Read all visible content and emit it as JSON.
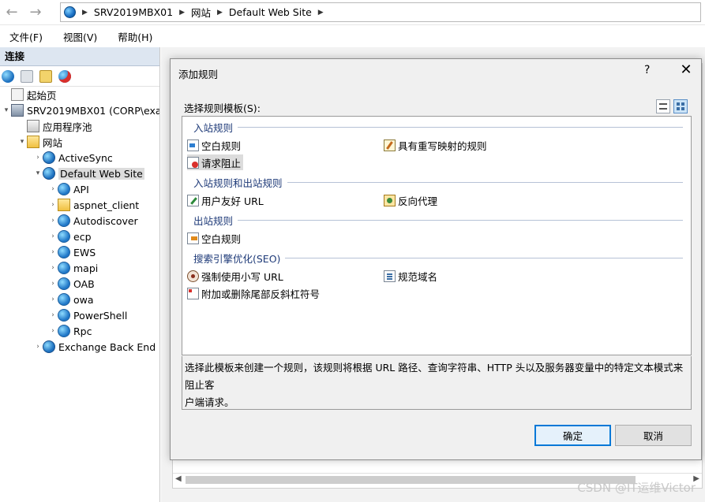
{
  "address_bar": {
    "back_icon": "back-arrow-icon",
    "forward_icon": "forward-arrow-icon",
    "crumbs": [
      "SRV2019MBX01",
      "网站",
      "Default Web Site"
    ]
  },
  "menu": [
    "文件(F)",
    "视图(V)",
    "帮助(H)"
  ],
  "connections": {
    "header": "连接",
    "tree": [
      {
        "label": "起始页",
        "level": 0,
        "icon": "start-page-icon",
        "twisty": ""
      },
      {
        "label": "SRV2019MBX01 (CORP\\exa",
        "level": 0,
        "icon": "server-icon",
        "twisty": "▾"
      },
      {
        "label": "应用程序池",
        "level": 1,
        "icon": "app-pool-icon",
        "twisty": ""
      },
      {
        "label": "网站",
        "level": 1,
        "icon": "sites-folder-icon",
        "twisty": "▾"
      },
      {
        "label": "ActiveSync",
        "level": 2,
        "icon": "site-icon",
        "twisty": "›"
      },
      {
        "label": "Default Web Site",
        "level": 2,
        "icon": "site-icon",
        "twisty": "▾",
        "selected": true
      },
      {
        "label": "API",
        "level": 3,
        "icon": "app-icon",
        "twisty": "›"
      },
      {
        "label": "aspnet_client",
        "level": 3,
        "icon": "folder-icon",
        "twisty": "›"
      },
      {
        "label": "Autodiscover",
        "level": 3,
        "icon": "app-icon",
        "twisty": "›"
      },
      {
        "label": "ecp",
        "level": 3,
        "icon": "app-icon",
        "twisty": "›"
      },
      {
        "label": "EWS",
        "level": 3,
        "icon": "app-icon",
        "twisty": "›"
      },
      {
        "label": "mapi",
        "level": 3,
        "icon": "app-icon",
        "twisty": "›"
      },
      {
        "label": "OAB",
        "level": 3,
        "icon": "app-icon",
        "twisty": "›"
      },
      {
        "label": "owa",
        "level": 3,
        "icon": "app-icon",
        "twisty": "›"
      },
      {
        "label": "PowerShell",
        "level": 3,
        "icon": "app-icon",
        "twisty": "›"
      },
      {
        "label": "Rpc",
        "level": 3,
        "icon": "app-icon",
        "twisty": "›"
      },
      {
        "label": "Exchange Back End",
        "level": 2,
        "icon": "site-icon",
        "twisty": "›"
      }
    ]
  },
  "dialog": {
    "title": "添加规则",
    "help": "?",
    "close": "✕",
    "prompt": "选择规则模板(S):",
    "groups": [
      {
        "title": "入站规则"
      },
      {
        "title": "入站规则和出站规则"
      },
      {
        "title": "出站规则"
      },
      {
        "title": "搜索引擎优化(SEO)"
      }
    ],
    "templates": {
      "blank_inbound": "空白规则",
      "rewrite_map": "具有重写映射的规则",
      "request_blocking": "请求阻止",
      "friendly_url": "用户友好 URL",
      "reverse_proxy": "反向代理",
      "blank_outbound": "空白规则",
      "lowercase_url": "强制使用小写 URL",
      "canonical_domain": "规范域名",
      "trailing_slash": "附加或删除尾部反斜杠符号"
    },
    "description_line1": "选择此模板来创建一个规则，该规则将根据 URL 路径、查询字符串、HTTP 头以及服务器变量中的特定文本模式来阻止客",
    "description_line2": "户端请求。",
    "ok": "确定",
    "cancel": "取消"
  },
  "watermark": "CSDN @IT运维Victor"
}
